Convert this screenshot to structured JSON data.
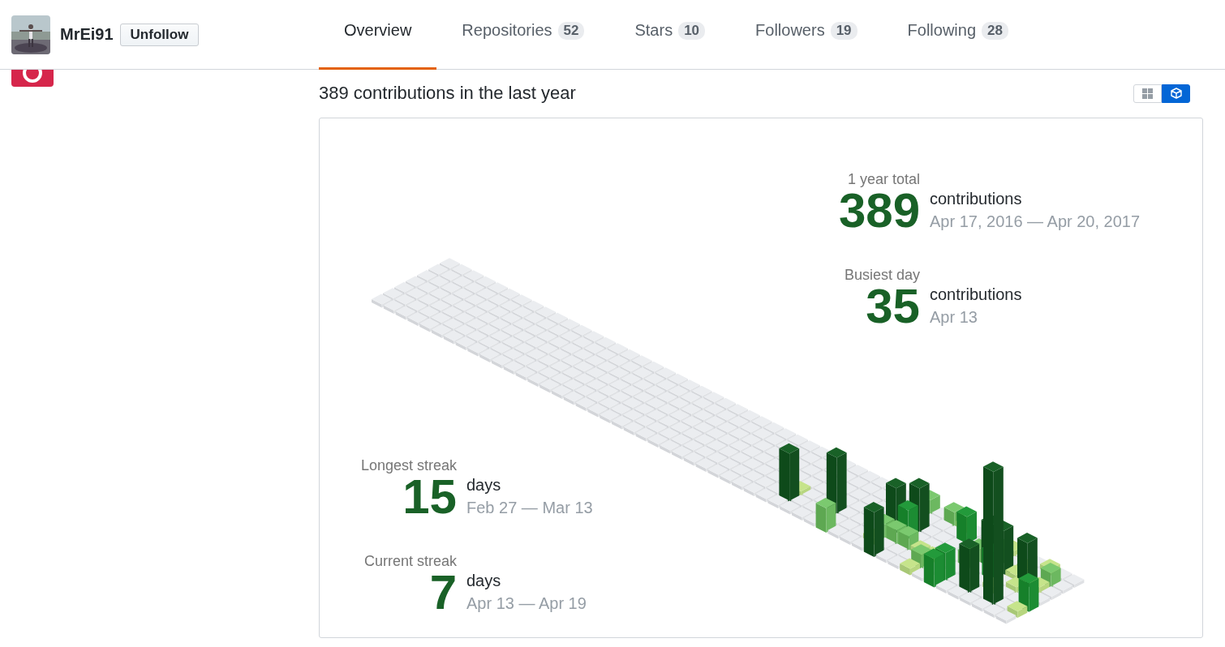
{
  "profile": {
    "username": "MrEi91",
    "follow_button": "Unfollow"
  },
  "tabs": [
    {
      "label": "Overview",
      "selected": true
    },
    {
      "label": "Repositories",
      "count": "52",
      "selected": false
    },
    {
      "label": "Stars",
      "count": "10",
      "selected": false
    },
    {
      "label": "Followers",
      "count": "19",
      "selected": false
    },
    {
      "label": "Following",
      "count": "28",
      "selected": false
    }
  ],
  "contributions": {
    "heading": "389 contributions in the last year",
    "view_toggle": [
      {
        "kind": "grid",
        "selected": false
      },
      {
        "kind": "cube",
        "selected": true
      }
    ],
    "summary": [
      {
        "label": "1 year total",
        "value": "389",
        "unit": "contributions",
        "range": "Apr 17, 2016 — Apr 20, 2017"
      },
      {
        "label": "Busiest day",
        "value": "35",
        "unit": "contributions",
        "range": "Apr 13"
      }
    ],
    "streaks": [
      {
        "label": "Longest streak",
        "value": "15",
        "unit": "days",
        "range": "Feb 27 — Mar 13"
      },
      {
        "label": "Current streak",
        "value": "7",
        "unit": "days",
        "range": "Apr 13 — Apr 19"
      }
    ]
  }
}
